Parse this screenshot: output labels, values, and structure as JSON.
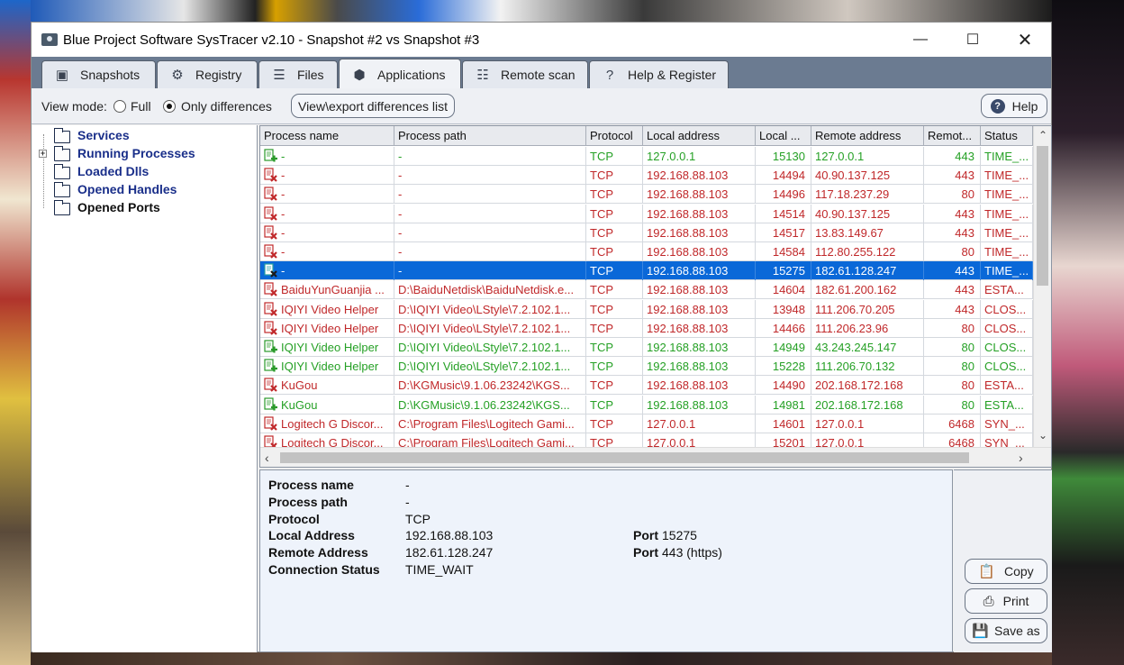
{
  "window": {
    "title": "Blue Project Software SysTracer v2.10 - Snapshot #2 vs Snapshot #3"
  },
  "tabs": [
    {
      "label": "Snapshots",
      "icon": "camera-icon"
    },
    {
      "label": "Registry",
      "icon": "registry-icon"
    },
    {
      "label": "Files",
      "icon": "files-icon"
    },
    {
      "label": "Applications",
      "icon": "applications-icon",
      "active": true
    },
    {
      "label": "Remote scan",
      "icon": "network-icon"
    },
    {
      "label": "Help & Register",
      "icon": "help-icon"
    }
  ],
  "toolbar": {
    "view_mode_label": "View mode:",
    "full_label": "Full",
    "only_diff_label": "Only differences",
    "selected_mode": "Only differences",
    "export_button": "View\\export differences list",
    "help_button": "Help"
  },
  "tree": [
    {
      "label": "Services",
      "color": "#1a2f8a",
      "expandable": false
    },
    {
      "label": "Running Processes",
      "color": "#1a2f8a",
      "expandable": true
    },
    {
      "label": "Loaded Dlls",
      "color": "#1a2f8a",
      "expandable": false
    },
    {
      "label": "Opened Handles",
      "color": "#1a2f8a",
      "expandable": false
    },
    {
      "label": "Opened Ports",
      "color": "#111111",
      "expandable": false
    }
  ],
  "columns": [
    "Process name",
    "Process path",
    "Protocol",
    "Local address",
    "Local ...",
    "Remote address",
    "Remot...",
    "Status"
  ],
  "rows": [
    {
      "state": "added",
      "name": "-",
      "path": "-",
      "protocol": "TCP",
      "local_address": "127.0.0.1",
      "local_port": "15130",
      "remote_address": "127.0.0.1",
      "remote_port": "443",
      "status": "TIME_..."
    },
    {
      "state": "removed",
      "name": "-",
      "path": "-",
      "protocol": "TCP",
      "local_address": "192.168.88.103",
      "local_port": "14494",
      "remote_address": "40.90.137.125",
      "remote_port": "443",
      "status": "TIME_..."
    },
    {
      "state": "removed",
      "name": "-",
      "path": "-",
      "protocol": "TCP",
      "local_address": "192.168.88.103",
      "local_port": "14496",
      "remote_address": "117.18.237.29",
      "remote_port": "80",
      "status": "TIME_..."
    },
    {
      "state": "removed",
      "name": "-",
      "path": "-",
      "protocol": "TCP",
      "local_address": "192.168.88.103",
      "local_port": "14514",
      "remote_address": "40.90.137.125",
      "remote_port": "443",
      "status": "TIME_..."
    },
    {
      "state": "removed",
      "name": "-",
      "path": "-",
      "protocol": "TCP",
      "local_address": "192.168.88.103",
      "local_port": "14517",
      "remote_address": "13.83.149.67",
      "remote_port": "443",
      "status": "TIME_..."
    },
    {
      "state": "removed",
      "name": "-",
      "path": "-",
      "protocol": "TCP",
      "local_address": "192.168.88.103",
      "local_port": "14584",
      "remote_address": "112.80.255.122",
      "remote_port": "80",
      "status": "TIME_..."
    },
    {
      "state": "selected",
      "name": "-",
      "path": "-",
      "protocol": "TCP",
      "local_address": "192.168.88.103",
      "local_port": "15275",
      "remote_address": "182.61.128.247",
      "remote_port": "443",
      "status": "TIME_..."
    },
    {
      "state": "removed",
      "name": "BaiduYunGuanjia ...",
      "path": "D:\\BaiduNetdisk\\BaiduNetdisk.e...",
      "protocol": "TCP",
      "local_address": "192.168.88.103",
      "local_port": "14604",
      "remote_address": "182.61.200.162",
      "remote_port": "443",
      "status": "ESTA..."
    },
    {
      "state": "removed",
      "name": "IQIYI Video Helper",
      "path": "D:\\IQIYI Video\\LStyle\\7.2.102.1...",
      "protocol": "TCP",
      "local_address": "192.168.88.103",
      "local_port": "13948",
      "remote_address": "111.206.70.205",
      "remote_port": "443",
      "status": "CLOS..."
    },
    {
      "state": "removed",
      "name": "IQIYI Video Helper",
      "path": "D:\\IQIYI Video\\LStyle\\7.2.102.1...",
      "protocol": "TCP",
      "local_address": "192.168.88.103",
      "local_port": "14466",
      "remote_address": "111.206.23.96",
      "remote_port": "80",
      "status": "CLOS..."
    },
    {
      "state": "added",
      "name": "IQIYI Video Helper",
      "path": "D:\\IQIYI Video\\LStyle\\7.2.102.1...",
      "protocol": "TCP",
      "local_address": "192.168.88.103",
      "local_port": "14949",
      "remote_address": "43.243.245.147",
      "remote_port": "80",
      "status": "CLOS..."
    },
    {
      "state": "added",
      "name": "IQIYI Video Helper",
      "path": "D:\\IQIYI Video\\LStyle\\7.2.102.1...",
      "protocol": "TCP",
      "local_address": "192.168.88.103",
      "local_port": "15228",
      "remote_address": "111.206.70.132",
      "remote_port": "80",
      "status": "CLOS..."
    },
    {
      "state": "removed",
      "name": "KuGou",
      "path": "D:\\KGMusic\\9.1.06.23242\\KGS...",
      "protocol": "TCP",
      "local_address": "192.168.88.103",
      "local_port": "14490",
      "remote_address": "202.168.172.168",
      "remote_port": "80",
      "status": "ESTA..."
    },
    {
      "state": "added",
      "name": "KuGou",
      "path": "D:\\KGMusic\\9.1.06.23242\\KGS...",
      "protocol": "TCP",
      "local_address": "192.168.88.103",
      "local_port": "14981",
      "remote_address": "202.168.172.168",
      "remote_port": "80",
      "status": "ESTA..."
    },
    {
      "state": "removed",
      "name": "Logitech G Discor...",
      "path": "C:\\Program Files\\Logitech Gami...",
      "protocol": "TCP",
      "local_address": "127.0.0.1",
      "local_port": "14601",
      "remote_address": "127.0.0.1",
      "remote_port": "6468",
      "status": "SYN_..."
    },
    {
      "state": "removed",
      "name": "Logitech G Discor...",
      "path": "C:\\Program Files\\Logitech Gami...",
      "protocol": "TCP",
      "local_address": "127.0.0.1",
      "local_port": "15201",
      "remote_address": "127.0.0.1",
      "remote_port": "6468",
      "status": "SYN_..."
    }
  ],
  "detail": {
    "process_name_label": "Process name",
    "process_name": "-",
    "process_path_label": "Process path",
    "process_path": "-",
    "protocol_label": "Protocol",
    "protocol": "TCP",
    "local_address_label": "Local Address",
    "local_address": "192.168.88.103",
    "remote_address_label": "Remote Address",
    "remote_address": "182.61.128.247",
    "status_label": "Connection Status",
    "status": "TIME_WAIT",
    "port_label": "Port",
    "local_port": "15275",
    "remote_port": "443 (https)"
  },
  "actions": {
    "copy": "Copy",
    "print": "Print",
    "save_as": "Save as"
  },
  "colors": {
    "added": "#25a025",
    "removed": "#c0282a",
    "selected": "#0a68d8",
    "tab_strip": "#6b7b91"
  }
}
